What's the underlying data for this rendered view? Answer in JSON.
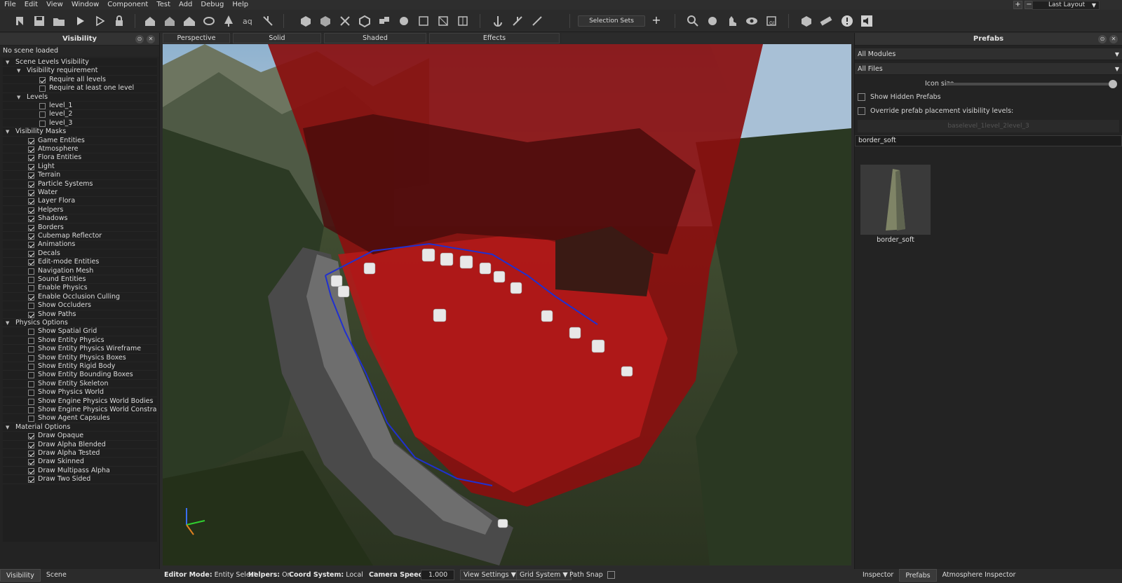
{
  "menu": [
    "File",
    "Edit",
    "View",
    "Window",
    "Component",
    "Test",
    "Add",
    "Debug",
    "Help"
  ],
  "layout_select": "Last Layout",
  "window_buttons": [
    "+",
    "−"
  ],
  "toolbar": {
    "selection_sets": "Selection Sets",
    "add_selection_set": "+"
  },
  "left_panel": {
    "title": "Visibility",
    "status": "No scene loaded",
    "tree": [
      {
        "label": "Scene Levels Visibility",
        "level": 0,
        "type": "group"
      },
      {
        "label": "Visibility requirement",
        "level": 1,
        "type": "group"
      },
      {
        "label": "Require all levels",
        "level": 2,
        "type": "check",
        "checked": true
      },
      {
        "label": "Require at least one level",
        "level": 2,
        "type": "check",
        "checked": false
      },
      {
        "label": "Levels",
        "level": 1,
        "type": "group"
      },
      {
        "label": "level_1",
        "level": 2,
        "type": "check",
        "checked": false
      },
      {
        "label": "level_2",
        "level": 2,
        "type": "check",
        "checked": false
      },
      {
        "label": "level_3",
        "level": 2,
        "type": "check",
        "checked": false
      },
      {
        "label": "Visibility Masks",
        "level": 0,
        "type": "group"
      },
      {
        "label": "Game Entities",
        "level": 1,
        "type": "check",
        "checked": true
      },
      {
        "label": "Atmosphere",
        "level": 1,
        "type": "check",
        "checked": true
      },
      {
        "label": "Flora Entities",
        "level": 1,
        "type": "check",
        "checked": true
      },
      {
        "label": "Light",
        "level": 1,
        "type": "check",
        "checked": true
      },
      {
        "label": "Terrain",
        "level": 1,
        "type": "check",
        "checked": true
      },
      {
        "label": "Particle Systems",
        "level": 1,
        "type": "check",
        "checked": true
      },
      {
        "label": "Water",
        "level": 1,
        "type": "check",
        "checked": true
      },
      {
        "label": "Layer Flora",
        "level": 1,
        "type": "check",
        "checked": true
      },
      {
        "label": "Helpers",
        "level": 1,
        "type": "check",
        "checked": true
      },
      {
        "label": "Shadows",
        "level": 1,
        "type": "check",
        "checked": true
      },
      {
        "label": "Borders",
        "level": 1,
        "type": "check",
        "checked": true
      },
      {
        "label": "Cubemap Reflector",
        "level": 1,
        "type": "check",
        "checked": true
      },
      {
        "label": "Animations",
        "level": 1,
        "type": "check",
        "checked": true
      },
      {
        "label": "Decals",
        "level": 1,
        "type": "check",
        "checked": true
      },
      {
        "label": "Edit-mode Entities",
        "level": 1,
        "type": "check",
        "checked": true
      },
      {
        "label": "Navigation Mesh",
        "level": 1,
        "type": "check",
        "checked": false
      },
      {
        "label": "Sound Entities",
        "level": 1,
        "type": "check",
        "checked": false
      },
      {
        "label": "Enable Physics",
        "level": 1,
        "type": "check",
        "checked": false
      },
      {
        "label": "Enable Occlusion Culling",
        "level": 1,
        "type": "check",
        "checked": true
      },
      {
        "label": "Show Occluders",
        "level": 1,
        "type": "check",
        "checked": false
      },
      {
        "label": "Show Paths",
        "level": 1,
        "type": "check",
        "checked": true
      },
      {
        "label": "Physics Options",
        "level": 0,
        "type": "group"
      },
      {
        "label": "Show Spatial Grid",
        "level": 1,
        "type": "check",
        "checked": false
      },
      {
        "label": "Show Entity Physics",
        "level": 1,
        "type": "check",
        "checked": false
      },
      {
        "label": "Show Entity Physics Wireframe",
        "level": 1,
        "type": "check",
        "checked": false
      },
      {
        "label": "Show Entity Physics Boxes",
        "level": 1,
        "type": "check",
        "checked": false
      },
      {
        "label": "Show Entity Rigid Body",
        "level": 1,
        "type": "check",
        "checked": false
      },
      {
        "label": "Show Entity Bounding Boxes",
        "level": 1,
        "type": "check",
        "checked": false
      },
      {
        "label": "Show Entity Skeleton",
        "level": 1,
        "type": "check",
        "checked": false
      },
      {
        "label": "Show Physics World",
        "level": 1,
        "type": "check",
        "checked": false
      },
      {
        "label": "Show Engine Physics World Bodies",
        "level": 1,
        "type": "check",
        "checked": false
      },
      {
        "label": "Show Engine Physics World Constrai...",
        "level": 1,
        "type": "check",
        "checked": false
      },
      {
        "label": "Show Agent Capsules",
        "level": 1,
        "type": "check",
        "checked": false
      },
      {
        "label": "Material Options",
        "level": 0,
        "type": "group"
      },
      {
        "label": "Draw Opaque",
        "level": 1,
        "type": "check",
        "checked": true
      },
      {
        "label": "Draw Alpha Blended",
        "level": 1,
        "type": "check",
        "checked": true
      },
      {
        "label": "Draw Alpha Tested",
        "level": 1,
        "type": "check",
        "checked": true
      },
      {
        "label": "Draw Skinned",
        "level": 1,
        "type": "check",
        "checked": true
      },
      {
        "label": "Draw Multipass Alpha",
        "level": 1,
        "type": "check",
        "checked": true
      },
      {
        "label": "Draw Two Sided",
        "level": 1,
        "type": "check",
        "checked": true
      }
    ],
    "tabs": [
      "Visibility",
      "Scene"
    ]
  },
  "viewport": {
    "tabs": [
      "Perspective",
      "Solid",
      "Shaded",
      "Effects"
    ]
  },
  "statusbar": {
    "editor_mode_label": "Editor Mode:",
    "editor_mode_value": "Entity Select",
    "helpers_label": "Helpers:",
    "helpers_value": "On",
    "coord_label": "Coord System:",
    "coord_value": "Local",
    "camera_speed_label": "Camera Speed:",
    "camera_speed_value": "1.000",
    "view_settings": "View Settings",
    "grid_system": "Grid System",
    "path_snap": "Path Snap"
  },
  "right_panel": {
    "title": "Prefabs",
    "modules_select": "All Modules",
    "files_select": "All Files",
    "icon_size_label": "Icon size",
    "icon_size_level": 1.0,
    "show_hidden_prefabs": "Show Hidden Prefabs",
    "override_visibility": "Override prefab placement visibility levels:",
    "levels_text": "baselevel_1level_2level_3",
    "search_value": "border_soft",
    "thumbnail_label": "border_soft",
    "tabs": [
      "Inspector",
      "Prefabs",
      "Atmosphere Inspector"
    ],
    "active_tab": "Prefabs"
  },
  "colors": {
    "accent": "#3a6ea5",
    "overlay_red": "#b30000",
    "path_blue": "#2030d0"
  }
}
